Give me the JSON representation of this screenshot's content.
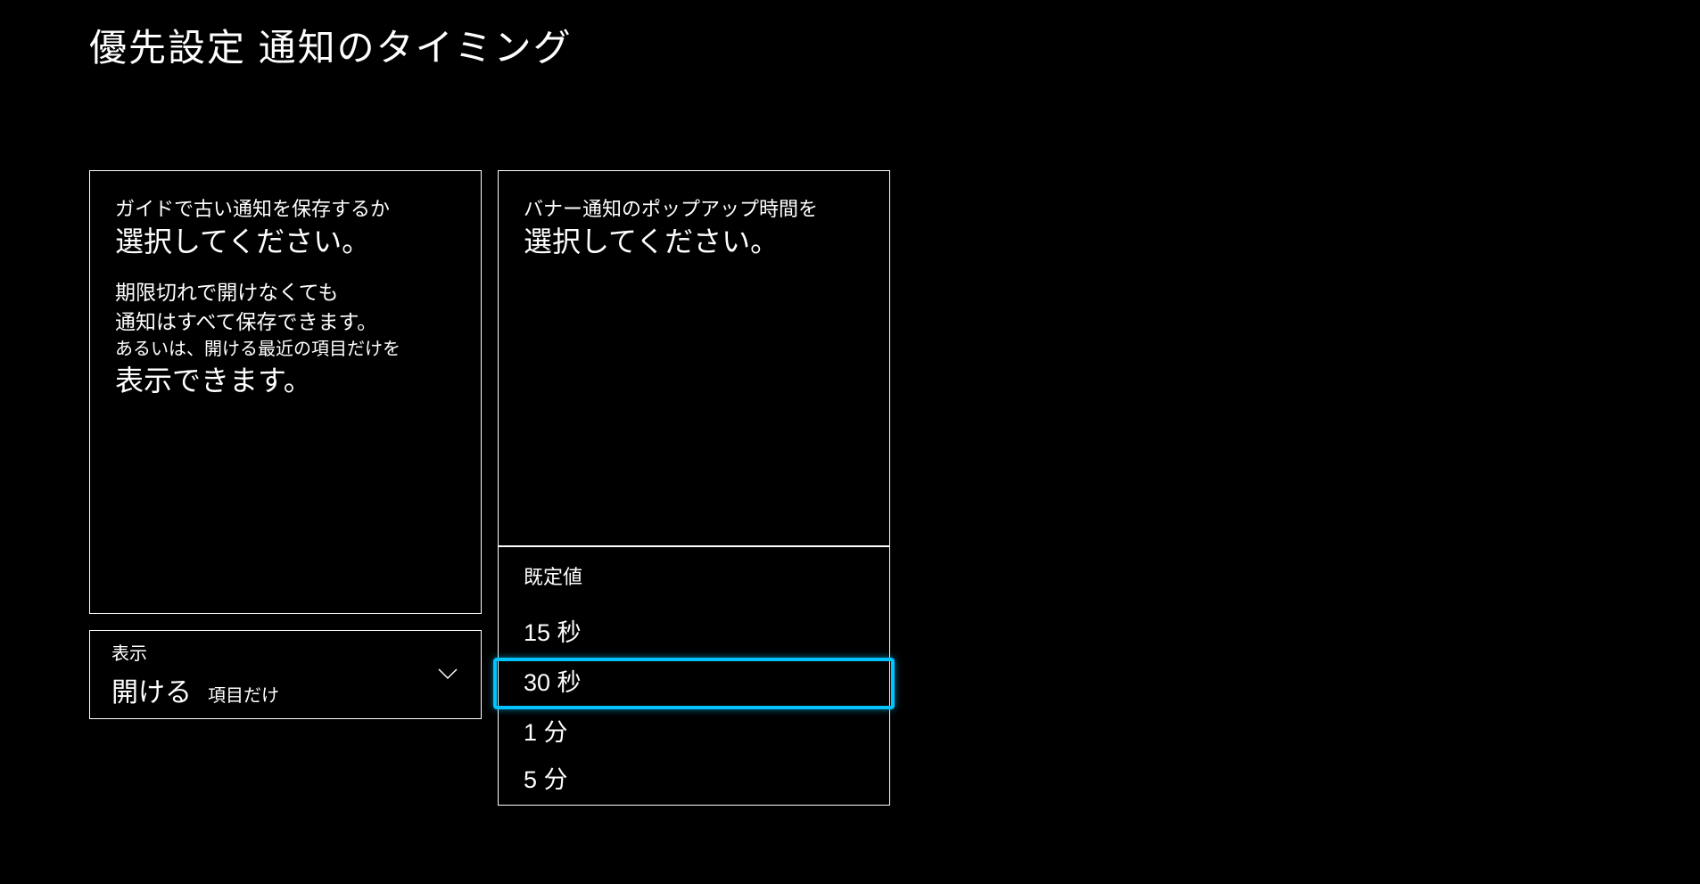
{
  "page": {
    "title": "優先設定 通知のタイミング"
  },
  "leftPanel": {
    "line1": "ガイドで古い通知を保存するか",
    "line2": "選択してください。",
    "line3": "期限切れで開けなくても",
    "line4": "通知はすべて保存できます。",
    "line5": "あるいは、開ける最近の項目だけを",
    "line6": "表示できます。"
  },
  "rightPanel": {
    "line1": "バナー通知のポップアップ時間を",
    "line2": "選択してください。"
  },
  "displayDropdown": {
    "label": "表示",
    "valueMain": "開ける",
    "valueSub": "項目だけ"
  },
  "timingDropdown": {
    "header": "既定値",
    "options": [
      "15 秒",
      "30 秒",
      "1 分",
      "5 分"
    ],
    "selectedIndex": 1
  },
  "colors": {
    "highlight": "#00c3ff"
  }
}
